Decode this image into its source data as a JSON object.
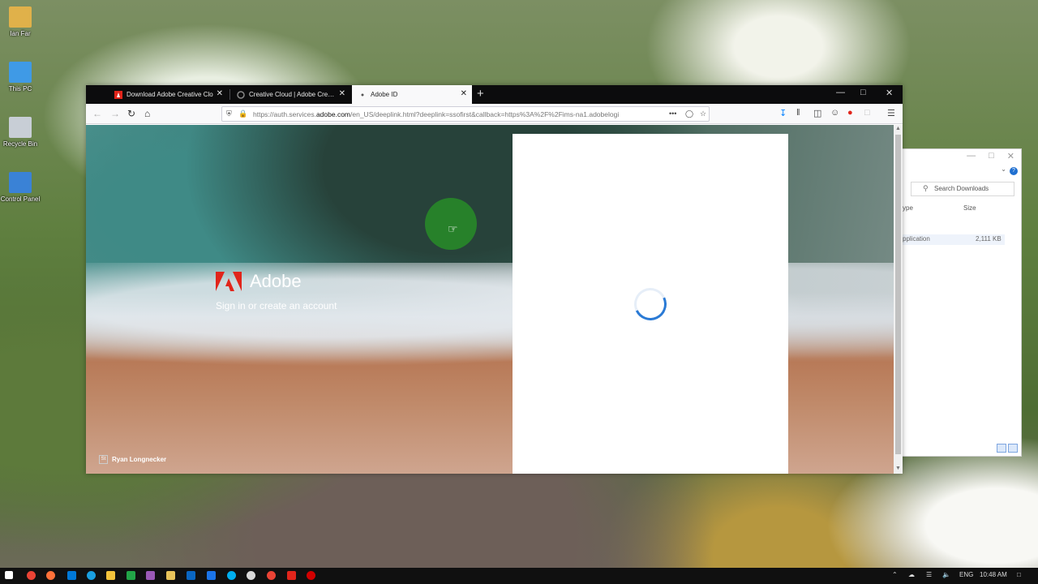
{
  "desktop": {
    "icons": [
      {
        "label": "Ian Far",
        "color": "#e0b14a"
      },
      {
        "label": "This PC",
        "color": "#3f9ae6"
      },
      {
        "label": "Recycle Bin",
        "color": "#c8ced6"
      },
      {
        "label": "Control Panel",
        "color": "#3a82d6"
      }
    ]
  },
  "explorer": {
    "search_placeholder": "Search Downloads",
    "col_type": "ype",
    "col_size": "Size",
    "file_type": "pplication",
    "file_size": "2,111 KB"
  },
  "browser": {
    "tabs": [
      {
        "title": "Download Adobe Creative Clo",
        "active": false
      },
      {
        "title": "Creative Cloud | Adobe Creativ",
        "active": false
      },
      {
        "title": "Adobe ID",
        "active": true
      }
    ],
    "url_prefix": "https://auth.services.",
    "url_domain": "adobe.com",
    "url_rest": "/en_US/deeplink.html?deeplink=ssofirst&callback=https%3A%2F%2Fims-na1.adobelogi"
  },
  "page": {
    "brand_name": "Adobe",
    "tagline": "Sign in or create an account",
    "photo_credit": "Ryan Longnecker",
    "st_badge": "St"
  },
  "taskbar": {
    "lang": "ENG",
    "time": "10:48 AM"
  },
  "colors": {
    "adobe_red": "#e1251b",
    "spinner_blue": "#2a7ad5",
    "cursor_green": "#2a8c2a"
  }
}
